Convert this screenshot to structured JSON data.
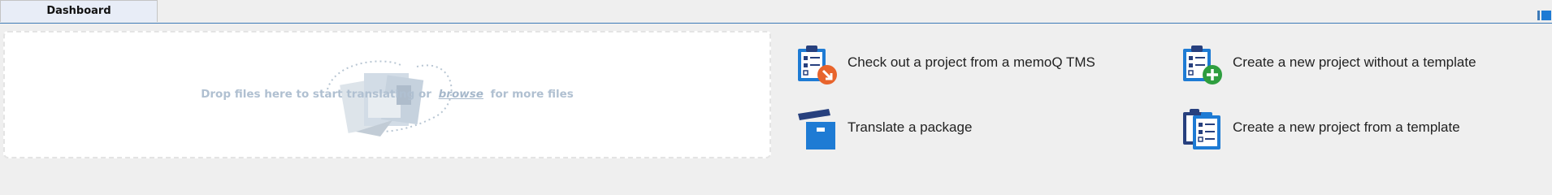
{
  "tabs": [
    {
      "label": "Dashboard"
    }
  ],
  "dropzone": {
    "prefix": "Drop files here to start translating or",
    "browse_label": "browse",
    "suffix": "for more files"
  },
  "actions": [
    {
      "label": "Check out a project from a memoQ TMS",
      "icon": "clipboard-download-icon"
    },
    {
      "label": "Create a new project without a template",
      "icon": "clipboard-add-icon"
    },
    {
      "label": "Translate a package",
      "icon": "package-box-icon"
    },
    {
      "label": "Create a new project from a template",
      "icon": "clipboard-template-icon"
    }
  ],
  "colors": {
    "accent": "#1e7bd4",
    "navy": "#27407e",
    "orange": "#e8642c",
    "green": "#2e9e3f"
  }
}
